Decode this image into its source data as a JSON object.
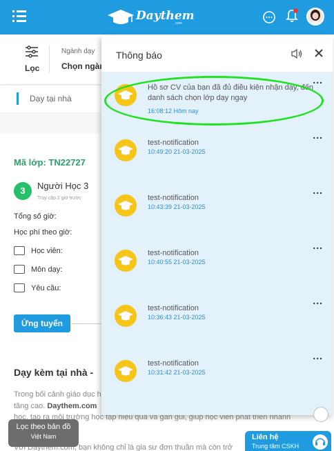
{
  "header": {
    "logo_text": "Daythem",
    "logo_sub": ".com",
    "bg_color": "#1f9be0"
  },
  "filter": {
    "label": "Lọc",
    "category_label": "Ngành dạy",
    "category_value": "Chọn ngành"
  },
  "breadcrumb": {
    "label": "Dạy tại nhà"
  },
  "class_info": {
    "code": "Mã lớp: TN22727",
    "student_number": "3",
    "student_name": "Người Học 3",
    "student_sub": "Truy cập 2 giờ trước",
    "total_hours": "Tổng số giờ:",
    "fee": "Học phí theo giờ:",
    "learner": "Học viên:",
    "subject": "Môn dạy:",
    "requirement": "Yêu cầu:"
  },
  "apply_button": "Ứng tuyển",
  "section": {
    "title": "Dạy kèm tại nhà -",
    "line1": "Trong bối cảnh giáo dục hi",
    "line2": "tăng cao.",
    "line2_bold": "Daythem.com",
    "line3": "học, tạo ra môi trường học tập hiệu quả và gần gũi, giúp học viên phát triển nhanh",
    "line4": "Với Daythem.com, bạn không chỉ là gia sư đơn thuần mà còn trở"
  },
  "map_button": {
    "line1": "Lọc theo bản đồ",
    "line2": "Việt Nam"
  },
  "contact": {
    "title": "Liên hệ",
    "subtitle": "Trung tâm CSKH"
  },
  "notifications": {
    "title": "Thông báo",
    "more": "...",
    "items": [
      {
        "text": "Hồ sơ CV của bạn đã đủ điều kiện nhận dạy, đến danh sách chọn lớp dạy ngay",
        "time": "16:08:12 Hôm nay"
      },
      {
        "text": "test-notification",
        "time": "10:49:20 21-03-2025"
      },
      {
        "text": "test-notification",
        "time": "10:43:39 21-03-2025"
      },
      {
        "text": "test-notification",
        "time": "10:40:55 21-03-2025"
      },
      {
        "text": "test-notification",
        "time": "10:36:43 21-03-2025"
      },
      {
        "text": "test-notification",
        "time": "10:31:42 21-03-2025"
      }
    ]
  }
}
